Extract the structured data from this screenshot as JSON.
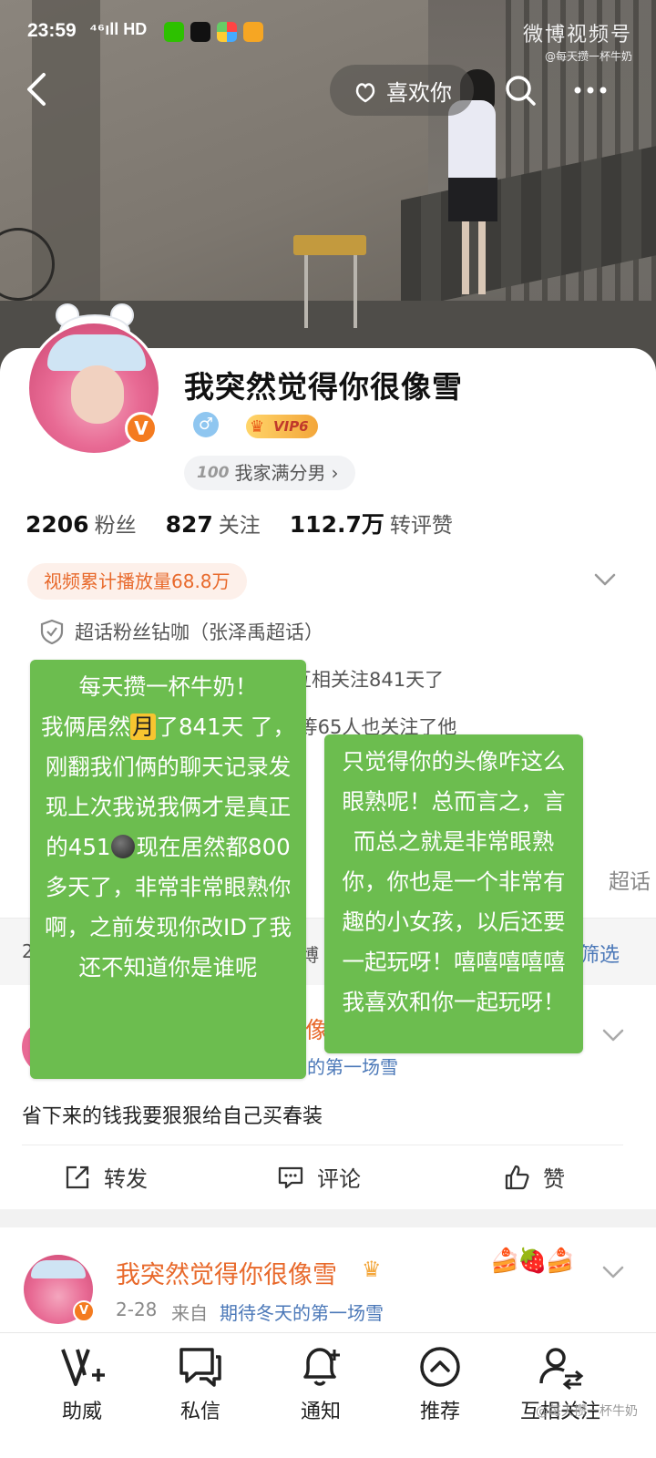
{
  "status_bar": {
    "time": "23:59",
    "signal": "⁴⁶ıll HD",
    "watermark_brand": "微博视频号",
    "watermark_handle": "@每天攒一杯牛奶"
  },
  "top_nav": {
    "like_label": "喜欢你"
  },
  "profile": {
    "nickname": "我突然觉得你很像雪",
    "vip_label": "VIP6",
    "verified_mark": "V",
    "gender_mark": "♂",
    "tag": "我家满分男",
    "tag_chevron": "›",
    "stats": [
      {
        "value": "2206",
        "label": "粉丝"
      },
      {
        "value": "827",
        "label": "关注"
      },
      {
        "value": "112.7万",
        "label": "转评赞"
      }
    ],
    "play_count": "视频累计播放量68.8万",
    "superfan": "超话粉丝钻咖（张泽禹超话）",
    "mutual_follow": "经互相关注841天了",
    "also_follow": "柏 等65人也关注了他",
    "super_link": "超话"
  },
  "tab_strip": {
    "count_prefix": "2",
    "weibo_label": "博",
    "filter_label": "筛选"
  },
  "post1": {
    "name_fragment": "像",
    "source_fragment": "的第一场雪",
    "text": "省下来的钱我要狠狠给自己买春装",
    "actions": {
      "repost": "转发",
      "comment": "评论",
      "like": "赞"
    }
  },
  "post2": {
    "name": "我突然觉得你很像雪",
    "date": "2-28",
    "from": "来自",
    "source": "期待冬天的第一场雪",
    "badge": "V"
  },
  "bottom_nav": [
    {
      "label": "助威",
      "icon": "cheer-icon"
    },
    {
      "label": "私信",
      "icon": "message-icon"
    },
    {
      "label": "通知",
      "icon": "bell-icon"
    },
    {
      "label": "推荐",
      "icon": "recommend-icon"
    },
    {
      "label": "互相关注",
      "icon": "mutual-follow-icon"
    }
  ],
  "watermark_bottom": "@每天攒一杯牛奶",
  "bubbles": {
    "left": {
      "line1": "每天攒一杯牛奶！",
      "line2_pre": "我俩居然",
      "line2_hl": "月",
      "line2_post": "了841天",
      "rest_a": "了，刚翻我们俩的聊天记录发现上次我说我俩才是真正的451",
      "rest_b": "现在居然都800多天了，非常非常眼熟你啊，之前发现你改ID了我还不知道你是谁呢"
    },
    "right": {
      "text": "只觉得你的头像咋这么眼熟呢！总而言之，言而总之就是非常眼熟你，你也是一个非常有趣的小女孩，以后还要一起玩呀！嘻嘻嘻嘻嘻我喜欢和你一起玩呀！"
    }
  },
  "colors": {
    "accent_orange": "#e8692b",
    "link_blue": "#4b78b8",
    "bubble_green": "#6cbd4f",
    "highlight_yellow": "#f7c530"
  }
}
